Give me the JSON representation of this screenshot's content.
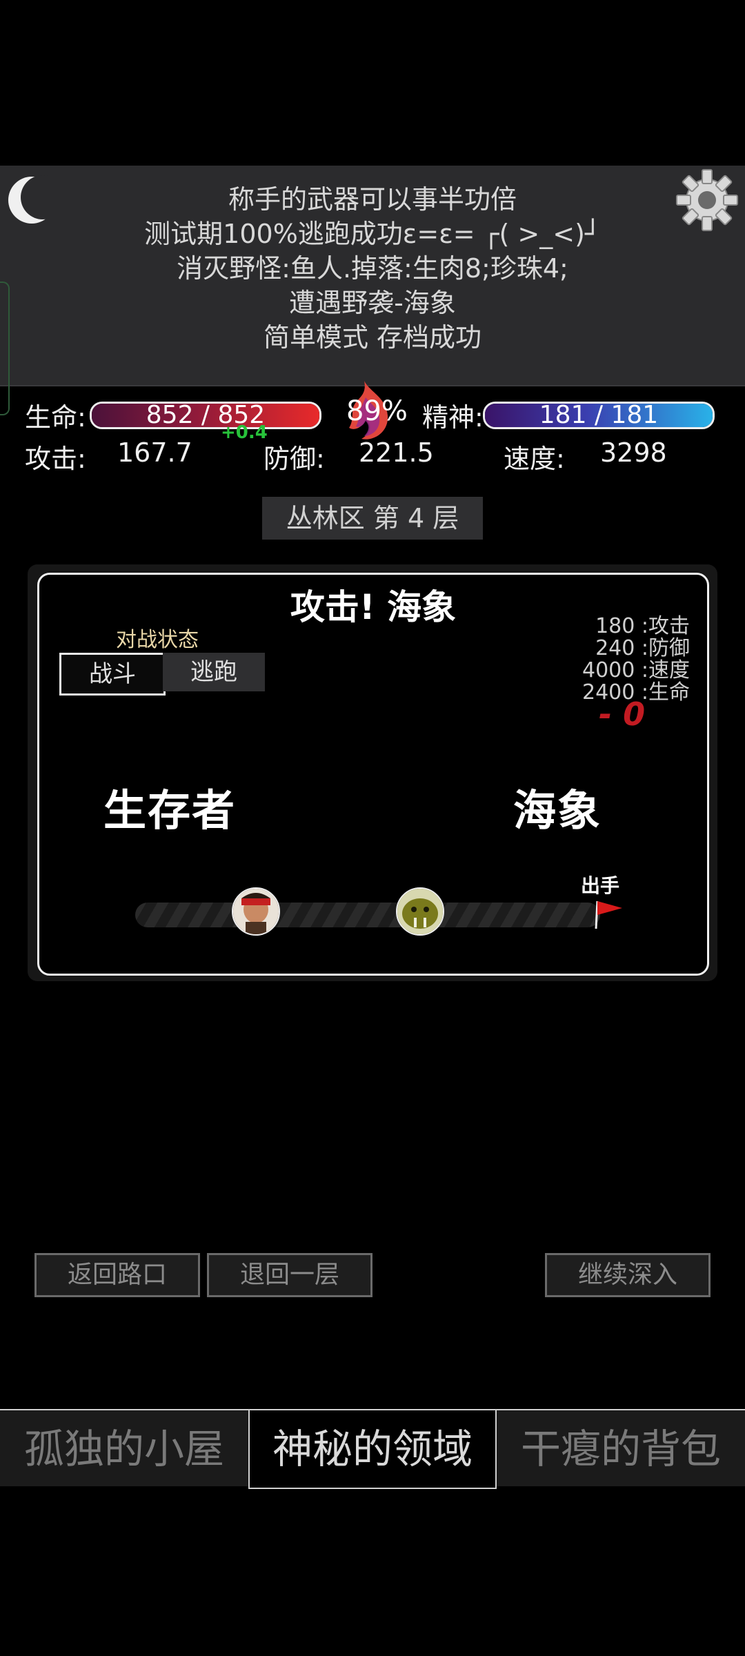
{
  "log": {
    "lines": [
      "称手的武器可以事半功倍",
      "测试期100%逃跑成功ε=ε= ┌( >_<)┘",
      "消灭野怪:鱼人.掉落:生肉8;珍珠4;",
      "遭遇野袭-海象",
      "简单模式 存档成功"
    ]
  },
  "stats": {
    "hp_label": "生命:",
    "hp_text": "852 / 852",
    "hp_fraction": 1.0,
    "hp_regen": "+0.4",
    "sanity_percent": "89%",
    "sp_label": "精神:",
    "sp_text": "181 / 181",
    "sp_fraction": 1.0,
    "atk_label": "攻击:",
    "atk_value": "167.7",
    "def_label": "防御:",
    "def_value": "221.5",
    "spd_label": "速度:",
    "spd_value": "3298"
  },
  "floor": "丛林区 第 4 层",
  "battle": {
    "title": "攻击! 海象",
    "mode_label": "对战状态",
    "fight_label": "战斗",
    "flee_label": "逃跑",
    "enemy_stats": [
      "180 :攻击",
      "240 :防御",
      "4000 :速度",
      "2400 :生命"
    ],
    "damage": "- 0",
    "player_name": "生存者",
    "enemy_name": "海象",
    "turn_label": "出手"
  },
  "nav": {
    "back_to_road": "返回路口",
    "back_one_floor": "退回一层",
    "go_deeper": "继续深入"
  },
  "tabs": [
    "孤独的小屋",
    "神秘的领域",
    "干瘪的背包"
  ],
  "colors": {
    "hp_bar": "#e82a2a",
    "sp_bar": "#29b2e8",
    "regen": "#27c23a",
    "damage": "#c21b22"
  }
}
